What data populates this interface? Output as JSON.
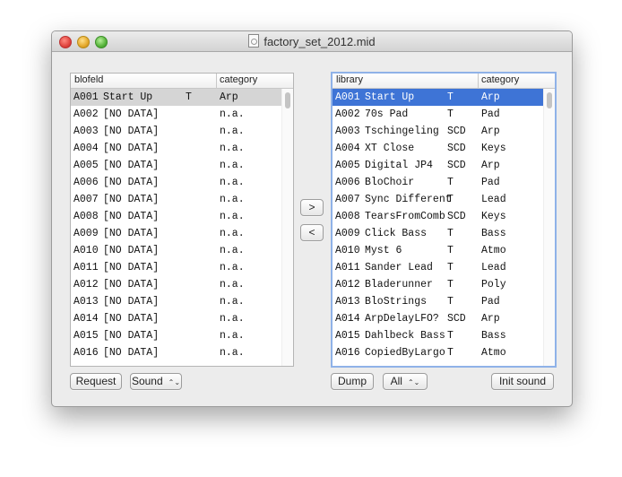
{
  "window": {
    "title": "factory_set_2012.mid"
  },
  "left": {
    "col1": "blofeld",
    "col2": "category",
    "rows": [
      {
        "num": "A001",
        "name": "Start Up",
        "type": "T",
        "cat": "Arp"
      },
      {
        "num": "A002",
        "name": "[NO DATA]",
        "type": "",
        "cat": "n.a."
      },
      {
        "num": "A003",
        "name": "[NO DATA]",
        "type": "",
        "cat": "n.a."
      },
      {
        "num": "A004",
        "name": "[NO DATA]",
        "type": "",
        "cat": "n.a."
      },
      {
        "num": "A005",
        "name": "[NO DATA]",
        "type": "",
        "cat": "n.a."
      },
      {
        "num": "A006",
        "name": "[NO DATA]",
        "type": "",
        "cat": "n.a."
      },
      {
        "num": "A007",
        "name": "[NO DATA]",
        "type": "",
        "cat": "n.a."
      },
      {
        "num": "A008",
        "name": "[NO DATA]",
        "type": "",
        "cat": "n.a."
      },
      {
        "num": "A009",
        "name": "[NO DATA]",
        "type": "",
        "cat": "n.a."
      },
      {
        "num": "A010",
        "name": "[NO DATA]",
        "type": "",
        "cat": "n.a."
      },
      {
        "num": "A011",
        "name": "[NO DATA]",
        "type": "",
        "cat": "n.a."
      },
      {
        "num": "A012",
        "name": "[NO DATA]",
        "type": "",
        "cat": "n.a."
      },
      {
        "num": "A013",
        "name": "[NO DATA]",
        "type": "",
        "cat": "n.a."
      },
      {
        "num": "A014",
        "name": "[NO DATA]",
        "type": "",
        "cat": "n.a."
      },
      {
        "num": "A015",
        "name": "[NO DATA]",
        "type": "",
        "cat": "n.a."
      },
      {
        "num": "A016",
        "name": "[NO DATA]",
        "type": "",
        "cat": "n.a."
      }
    ]
  },
  "right": {
    "col1": "library",
    "col2": "category",
    "rows": [
      {
        "num": "A001",
        "name": "Start Up",
        "type": "T",
        "cat": "Arp"
      },
      {
        "num": "A002",
        "name": "70s Pad",
        "type": "T",
        "cat": "Pad"
      },
      {
        "num": "A003",
        "name": "Tschingeling",
        "type": "SCD",
        "cat": "Arp"
      },
      {
        "num": "A004",
        "name": "XT Close",
        "type": "SCD",
        "cat": "Keys"
      },
      {
        "num": "A005",
        "name": "Digital JP4",
        "type": "SCD",
        "cat": "Arp"
      },
      {
        "num": "A006",
        "name": "BloChoir",
        "type": "T",
        "cat": "Pad"
      },
      {
        "num": "A007",
        "name": "Sync Different",
        "type": "T",
        "cat": "Lead"
      },
      {
        "num": "A008",
        "name": "TearsFromComb",
        "type": "SCD",
        "cat": "Keys"
      },
      {
        "num": "A009",
        "name": "Click Bass",
        "type": "T",
        "cat": "Bass"
      },
      {
        "num": "A010",
        "name": "Myst 6",
        "type": "T",
        "cat": "Atmo"
      },
      {
        "num": "A011",
        "name": "Sander Lead",
        "type": "T",
        "cat": "Lead"
      },
      {
        "num": "A012",
        "name": "Bladerunner",
        "type": "T",
        "cat": "Poly"
      },
      {
        "num": "A013",
        "name": "BloStrings",
        "type": "T",
        "cat": "Pad"
      },
      {
        "num": "A014",
        "name": "ArpDelayLFO?",
        "type": "SCD",
        "cat": "Arp"
      },
      {
        "num": "A015",
        "name": "Dahlbeck Bass",
        "type": "T",
        "cat": "Bass"
      },
      {
        "num": "A016",
        "name": "CopiedByLargo",
        "type": "T",
        "cat": "Atmo"
      }
    ]
  },
  "buttons": {
    "copy_right": ">",
    "copy_left": "<",
    "request": "Request",
    "sound_popup": "Sound",
    "dump": "Dump",
    "all_popup": "All",
    "init_sound": "Init sound",
    "popup_arrow": "⌃⌄"
  }
}
